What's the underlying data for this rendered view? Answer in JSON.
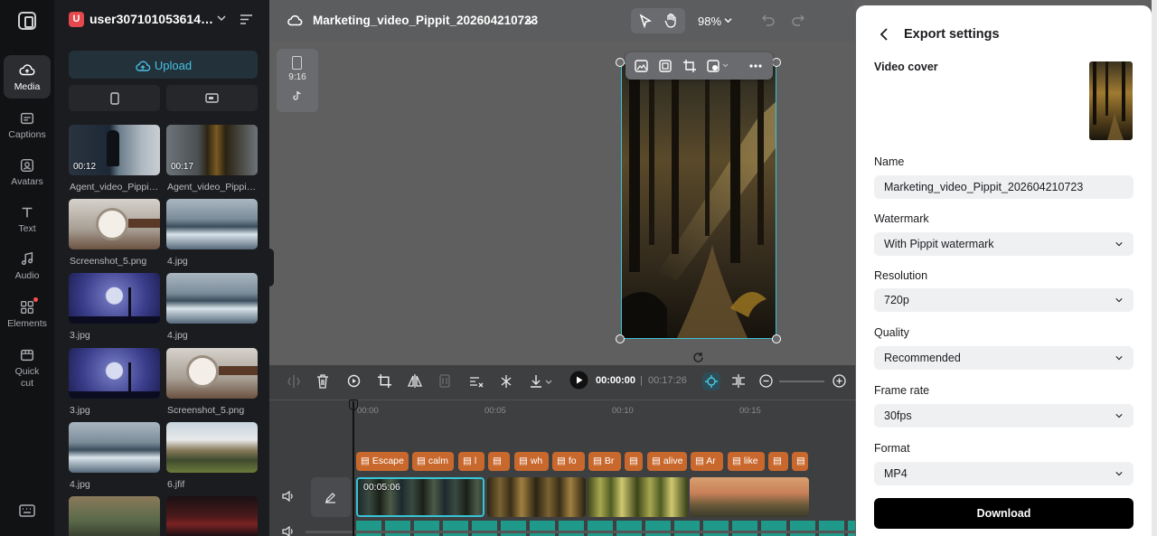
{
  "rail": {
    "items": [
      {
        "label": "Media",
        "icon": "cloud-media-icon"
      },
      {
        "label": "Captions",
        "icon": "captions-icon"
      },
      {
        "label": "Avatars",
        "icon": "avatar-icon"
      },
      {
        "label": "Text",
        "icon": "text-icon"
      },
      {
        "label": "Audio",
        "icon": "music-note-icon"
      },
      {
        "label": "Elements",
        "icon": "elements-icon"
      },
      {
        "label": "Quick",
        "label2": "cut",
        "icon": "quick-cut-icon"
      }
    ]
  },
  "panel": {
    "user_initial": "U",
    "user_name": "user3071010536145…",
    "upload_label": "Upload",
    "items": [
      {
        "label": "Agent_video_Pippi…",
        "duration": "00:12",
        "kind": "night-figure"
      },
      {
        "label": "Agent_video_Pippi…",
        "duration": "00:17",
        "kind": "forest"
      },
      {
        "label": "Screenshot_5.png",
        "kind": "watch"
      },
      {
        "label": "4.jpg",
        "kind": "coast"
      },
      {
        "label": "3.jpg",
        "kind": "moon"
      },
      {
        "label": "4.jpg",
        "kind": "coast"
      },
      {
        "label": "3.jpg",
        "kind": "moon"
      },
      {
        "label": "Screenshot_5.png",
        "kind": "watch"
      },
      {
        "label": "4.jpg",
        "kind": "coast"
      },
      {
        "label": "6.jfif",
        "kind": "crowd"
      },
      {
        "label": "",
        "kind": "sunset"
      },
      {
        "label": "",
        "kind": "city-night"
      }
    ]
  },
  "topbar": {
    "project_name": "Marketing_video_Pippit_202604210723",
    "zoom": "98%"
  },
  "canvas": {
    "ratio_label": "9:16"
  },
  "timeline": {
    "current_time": "00:00:00",
    "separator": "|",
    "total_time": "00:17:26",
    "ruler": [
      "00:00",
      "00:05",
      "00:10",
      "00:15"
    ],
    "captions": [
      "Escape",
      "calm",
      "l",
      "",
      "wh",
      "fo",
      "Br",
      "",
      "alive",
      "Ar",
      "like",
      "",
      ""
    ],
    "clip_duration": "00:05:06"
  },
  "export": {
    "title": "Export settings",
    "video_cover_label": "Video cover",
    "name_label": "Name",
    "name_value": "Marketing_video_Pippit_202604210723",
    "watermark_label": "Watermark",
    "watermark_value": "With Pippit watermark",
    "resolution_label": "Resolution",
    "resolution_value": "720p",
    "quality_label": "Quality",
    "quality_value": "Recommended",
    "framerate_label": "Frame rate",
    "framerate_value": "30fps",
    "format_label": "Format",
    "format_value": "MP4",
    "download_label": "Download"
  },
  "colors": {
    "accent": "#38c3d6",
    "caption_chip": "#c9682d",
    "panel_bg": "#1b1c1f"
  }
}
